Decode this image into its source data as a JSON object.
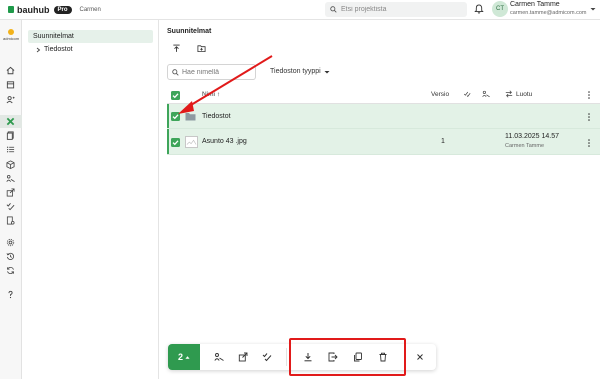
{
  "topbar": {
    "brand": "bauhub",
    "pro_badge": "Pro",
    "company": "Carmen",
    "search_placeholder": "Etsi projektista",
    "avatar_initials": "CT",
    "user_name": "Carmen Tamme",
    "user_email": "carmen.tamme@admicom.com"
  },
  "rail": {
    "logo_text": "admicom"
  },
  "tree": {
    "root": "Suunnitelmat",
    "child": "Tiedostot"
  },
  "main": {
    "title": "Suunnitelmat",
    "filter_placeholder": "Hae nimellä",
    "type_filter": "Tiedoston tyyppi"
  },
  "table": {
    "headers": {
      "name": "Nimi",
      "version": "Versio",
      "created": "Luotu"
    },
    "rows": [
      {
        "name": "Tiedostot",
        "version": "",
        "date": "",
        "author": ""
      },
      {
        "name": "Asunto 43 .jpg",
        "version": "1",
        "date": "11.03.2025 14.57",
        "author": "Carmen Tamme"
      }
    ]
  },
  "bottom_bar": {
    "selected_count": "2"
  },
  "colors": {
    "accent": "#3ea55a",
    "selected_row": "#e3f2e7",
    "annotation_red": "#e11a1a"
  }
}
